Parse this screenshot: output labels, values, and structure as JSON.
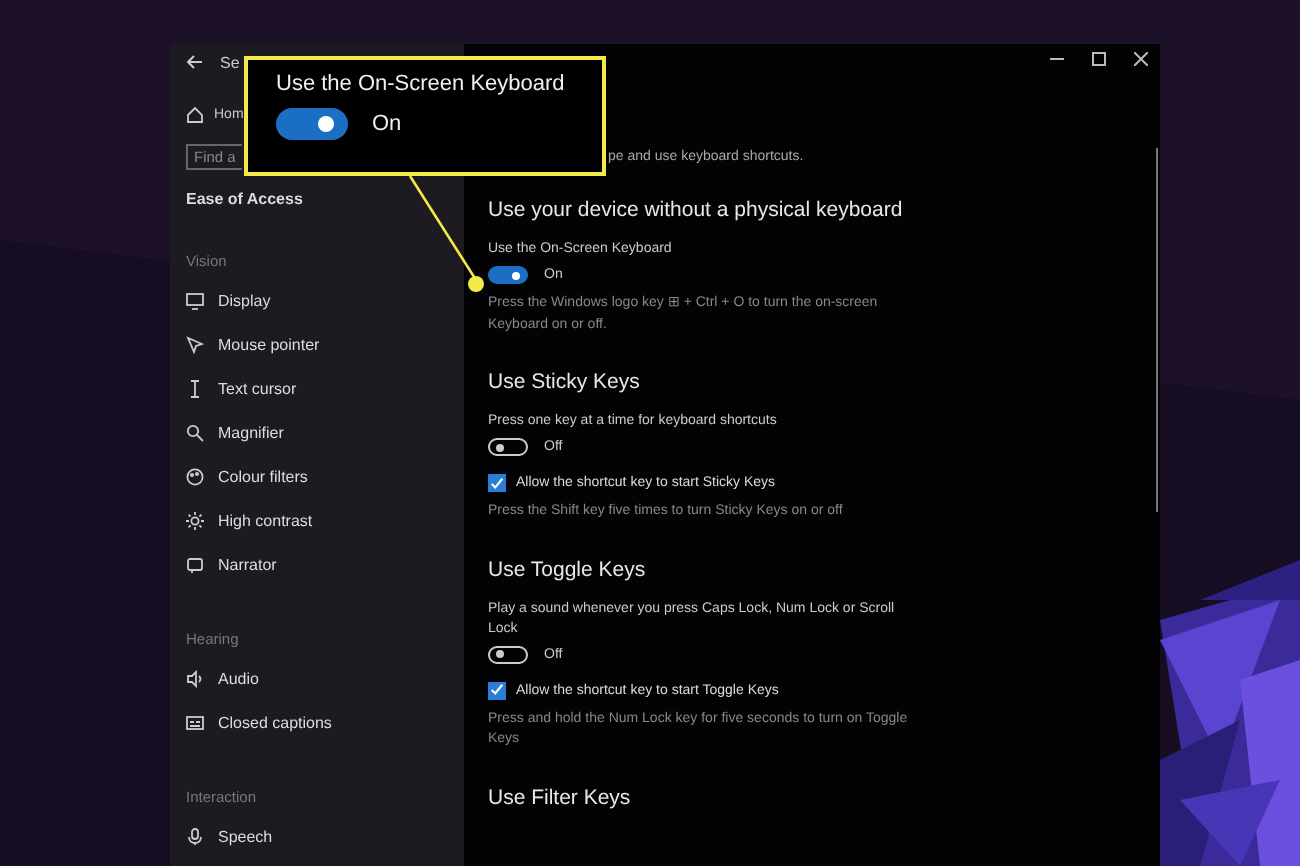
{
  "window": {
    "title": "Se"
  },
  "sidebar": {
    "home": "Hom",
    "search": {
      "placeholder": "Find a"
    },
    "section_title": "Ease of Access",
    "groups": [
      {
        "label": "Vision",
        "items": [
          "Display",
          "Mouse pointer",
          "Text cursor",
          "Magnifier",
          "Colour filters",
          "High contrast",
          "Narrator"
        ]
      },
      {
        "label": "Hearing",
        "items": [
          "Audio",
          "Closed captions"
        ]
      },
      {
        "label": "Interaction",
        "items": [
          "Speech"
        ]
      }
    ]
  },
  "content": {
    "intro": "pe and use keyboard shortcuts.",
    "sections": [
      {
        "heading": "Use your device without a physical keyboard",
        "items": [
          {
            "kind": "toggle",
            "label": "Use the On-Screen Keyboard",
            "on": true,
            "state_text": "On"
          },
          {
            "kind": "text",
            "text": "Press the Windows logo key ⊞ + Ctrl + O to turn the on-screen Keyboard on or off."
          }
        ]
      },
      {
        "heading": "Use Sticky Keys",
        "items": [
          {
            "kind": "toggle",
            "label": "Press one key at a time for keyboard shortcuts",
            "on": false,
            "state_text": "Off"
          },
          {
            "kind": "checkbox",
            "label": "Allow the shortcut key to start Sticky Keys",
            "checked": true
          },
          {
            "kind": "text",
            "text": "Press the Shift key five times to turn Sticky Keys on or off"
          }
        ]
      },
      {
        "heading": "Use Toggle Keys",
        "items": [
          {
            "kind": "toggle",
            "label": "Play a sound whenever you press Caps Lock, Num Lock or Scroll Lock",
            "on": false,
            "state_text": "Off"
          },
          {
            "kind": "checkbox",
            "label": "Allow the shortcut key to start Toggle Keys",
            "checked": true
          },
          {
            "kind": "text",
            "text": "Press and hold the Num Lock key for five seconds to turn on Toggle Keys"
          }
        ]
      },
      {
        "heading": "Use Filter Keys"
      }
    ]
  },
  "callout": {
    "label": "Use the On-Screen Keyboard",
    "on": true,
    "state_text": "On"
  }
}
